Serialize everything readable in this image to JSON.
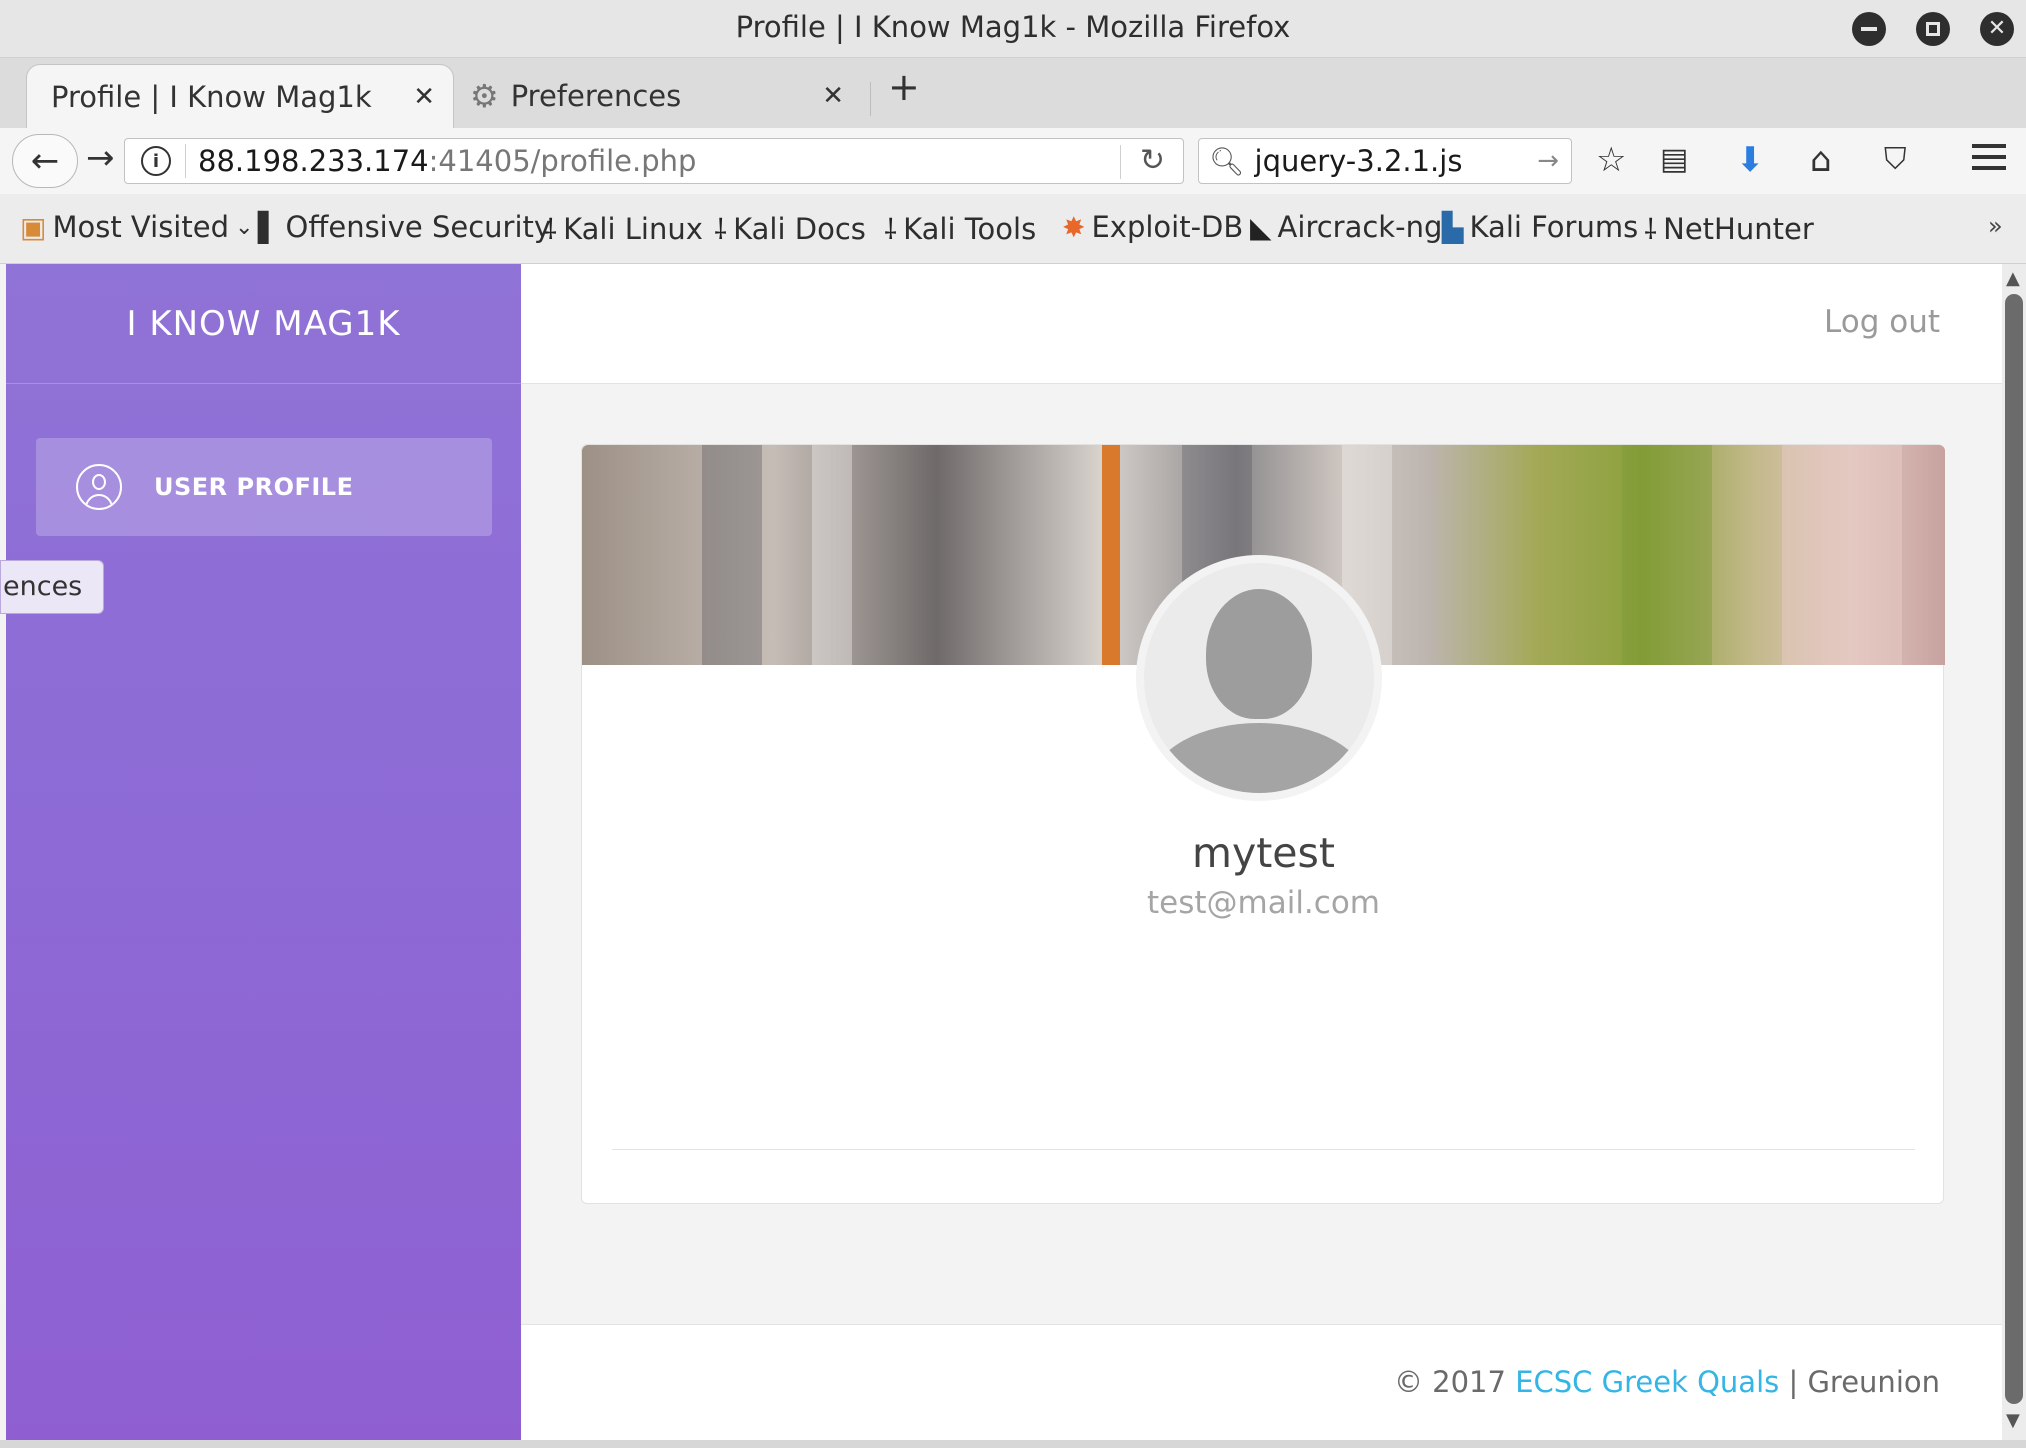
{
  "window": {
    "title": "Profile | I Know Mag1k - Mozilla Firefox"
  },
  "tabs": [
    {
      "label": "Profile | I Know Mag1k",
      "active": true
    },
    {
      "label": "Preferences",
      "active": false,
      "icon": "gear-icon"
    }
  ],
  "navbar": {
    "url_host": "88.198.233.174",
    "url_path": ":41405/profile.php",
    "search_value": "jquery-3.2.1.js"
  },
  "bookmarks": [
    {
      "label": "Most Visited",
      "icon": "folder-icon"
    },
    {
      "label": "Offensive Security",
      "icon": "offsec-icon"
    },
    {
      "label": "Kali Linux",
      "icon": "kali-dragon-icon"
    },
    {
      "label": "Kali Docs",
      "icon": "kali-dragon-icon"
    },
    {
      "label": "Kali Tools",
      "icon": "kali-dragon-icon"
    },
    {
      "label": "Exploit-DB",
      "icon": "exploitdb-icon"
    },
    {
      "label": "Aircrack-ng",
      "icon": "aircrack-icon"
    },
    {
      "label": "Kali Forums",
      "icon": "kali-forums-icon"
    },
    {
      "label": "NetHunter",
      "icon": "kali-dragon-icon"
    }
  ],
  "sidebar": {
    "brand": "I KNOW MAG1K",
    "items": [
      {
        "label": "USER PROFILE",
        "icon": "user-icon"
      }
    ],
    "tooltip": "ences"
  },
  "header": {
    "logout": "Log out"
  },
  "profile": {
    "username": "mytest",
    "email": "test@mail.com"
  },
  "footer": {
    "copyright": "© 2017 ",
    "link": "ECSC Greek Quals",
    "sep": " | ",
    "author": "Greunion"
  },
  "colors": {
    "sidebar": "#8f69d4",
    "accent_link": "#33b5e5"
  }
}
